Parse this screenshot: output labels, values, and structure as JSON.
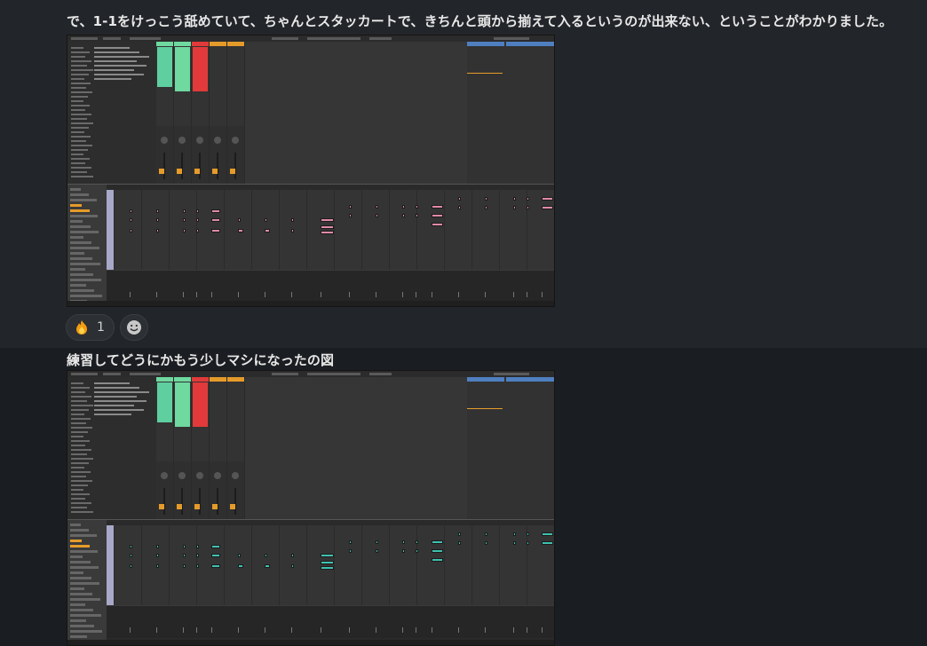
{
  "messages": [
    {
      "text": "で、1-1をけっこう舐めていて、ちゃんとスタッカートで、きちんと頭から揃えて入るというのが出来ない、ということがわかりました。",
      "attachment": "screenshot-before",
      "note_color": "#e08aa8",
      "reactions": [
        {
          "emoji": "fire-icon",
          "count": "1"
        }
      ]
    },
    {
      "text": "練習してどうにかもう少しマシになったの図",
      "attachment": "screenshot-after",
      "note_color": "#3fc1b0"
    }
  ],
  "colors": {
    "clip_green": "#6fd9a0",
    "clip_red": "#e23a3a",
    "clip_orange": "#e59b2a",
    "clip_blue": "#4f7fbf"
  }
}
